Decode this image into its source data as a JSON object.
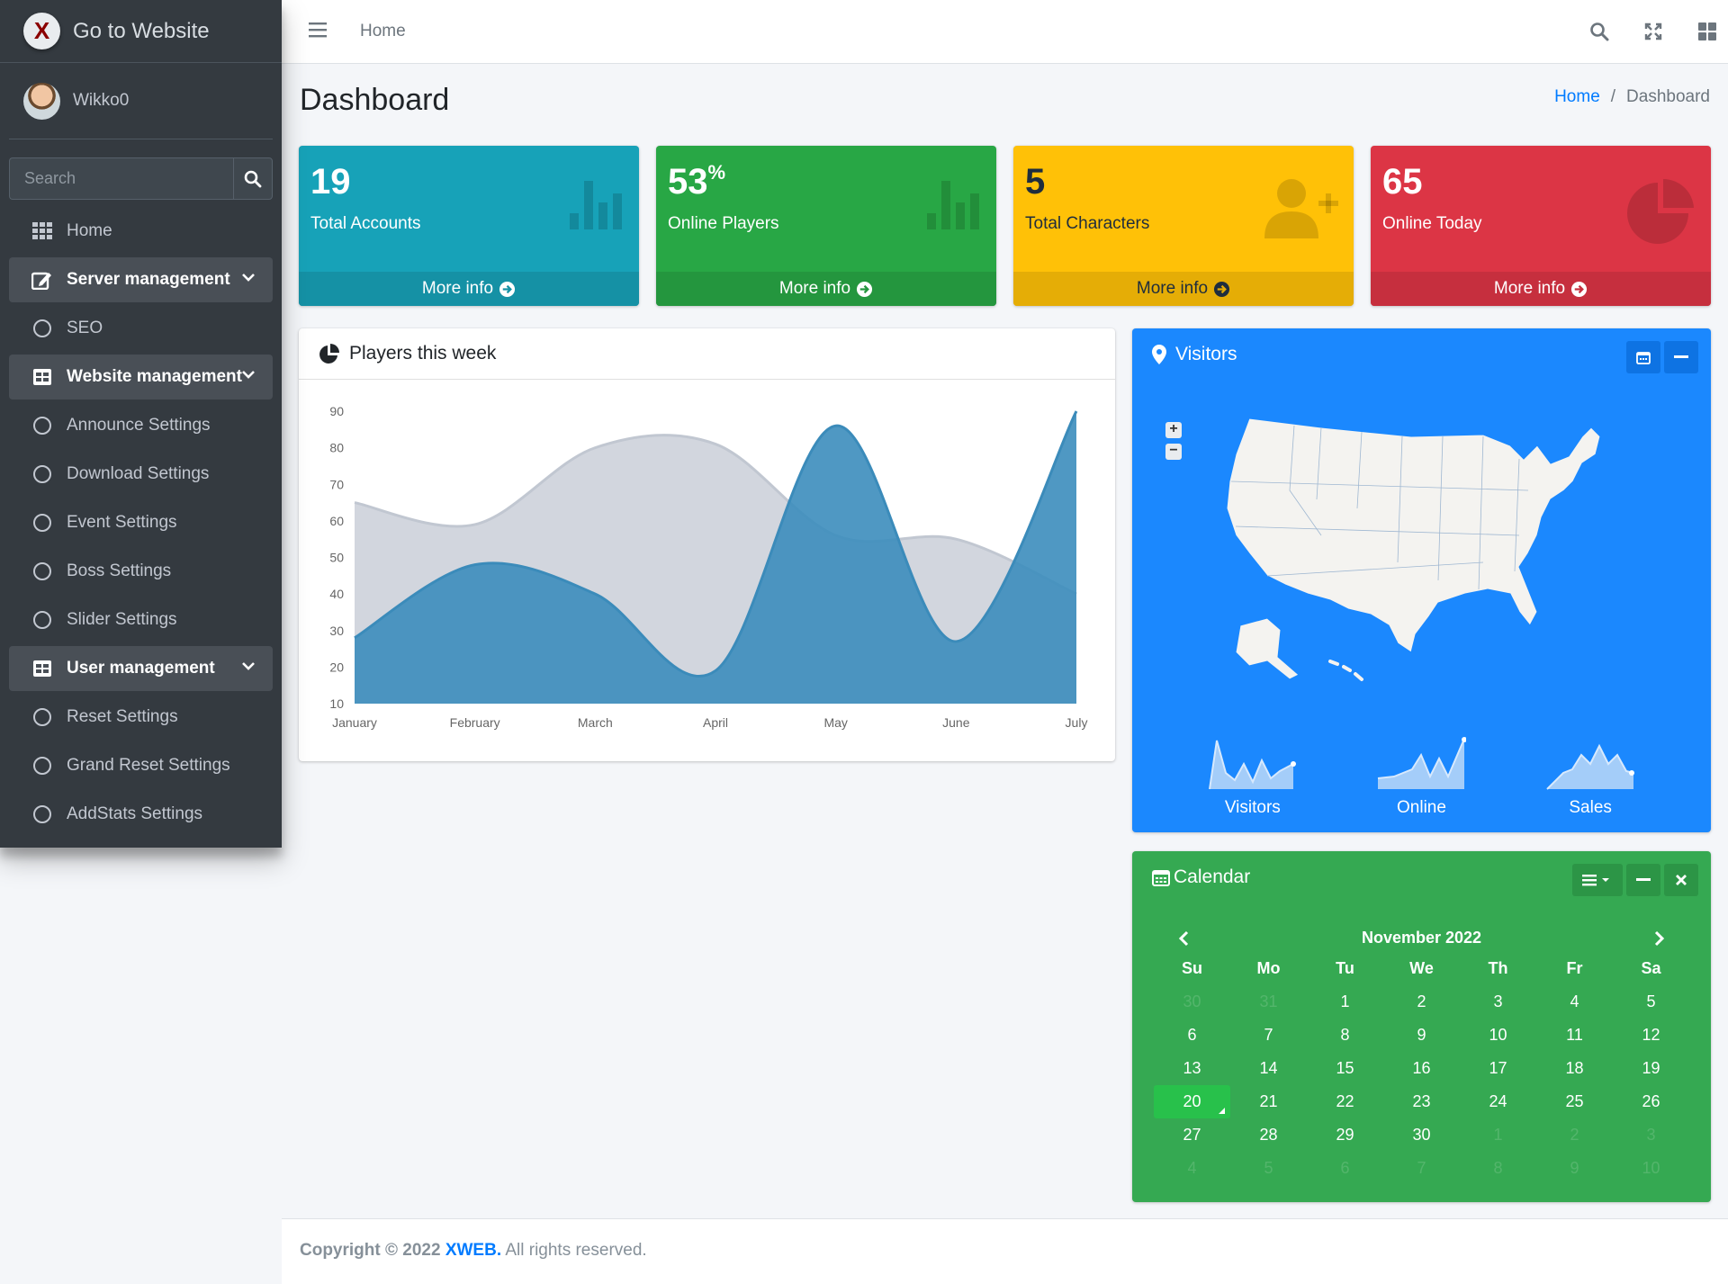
{
  "brand": {
    "logo_letter": "X",
    "title": "Go to Website"
  },
  "user": {
    "name": "Wikko0"
  },
  "search": {
    "placeholder": "Search"
  },
  "sidebar": {
    "items": [
      {
        "label": "Home"
      },
      {
        "label": "Server management"
      },
      {
        "label": "SEO"
      },
      {
        "label": "Website management"
      },
      {
        "label": "Announce Settings"
      },
      {
        "label": "Download Settings"
      },
      {
        "label": "Event Settings"
      },
      {
        "label": "Boss Settings"
      },
      {
        "label": "Slider Settings"
      },
      {
        "label": "User management"
      },
      {
        "label": "Reset Settings"
      },
      {
        "label": "Grand Reset Settings"
      },
      {
        "label": "AddStats Settings"
      }
    ]
  },
  "topbar": {
    "home": "Home"
  },
  "header": {
    "title": "Dashboard",
    "breadcrumb_home": "Home",
    "breadcrumb_sep": "/",
    "breadcrumb_current": "Dashboard"
  },
  "stats": [
    {
      "value": "19",
      "suffix": "",
      "label": "Total Accounts",
      "more": "More info",
      "color": "#17a2b8"
    },
    {
      "value": "53",
      "suffix": "%",
      "label": "Online Players",
      "more": "More info",
      "color": "#28a745"
    },
    {
      "value": "5",
      "suffix": "",
      "label": "Total Characters",
      "more": "More info",
      "color": "#ffc107"
    },
    {
      "value": "65",
      "suffix": "",
      "label": "Online Today",
      "more": "More info",
      "color": "#dc3545"
    }
  ],
  "players_card": {
    "title": "Players this week"
  },
  "chart_data": {
    "type": "area",
    "categories": [
      "January",
      "February",
      "March",
      "April",
      "May",
      "June",
      "July"
    ],
    "series": [
      {
        "values": [
          65,
          59,
          80,
          81,
          56,
          55,
          40
        ],
        "color": "#d2d6de"
      },
      {
        "values": [
          28,
          48,
          40,
          19,
          86,
          27,
          90
        ],
        "color": "#3c8dbc"
      }
    ],
    "ylim": [
      10,
      90
    ],
    "yticks": [
      "90",
      "80",
      "70",
      "60",
      "50",
      "40",
      "30",
      "20",
      "10"
    ],
    "grid": false
  },
  "visitors": {
    "title": "Visitors",
    "sparks": [
      {
        "label": "Visitors"
      },
      {
        "label": "Online"
      },
      {
        "label": "Sales"
      }
    ],
    "color": "#1b88fe"
  },
  "calendar": {
    "title": "Calendar",
    "month": "November 2022",
    "dow": [
      "Su",
      "Mo",
      "Tu",
      "We",
      "Th",
      "Fr",
      "Sa"
    ],
    "weeks": [
      [
        "30",
        "31",
        "1",
        "2",
        "3",
        "4",
        "5"
      ],
      [
        "6",
        "7",
        "8",
        "9",
        "10",
        "11",
        "12"
      ],
      [
        "13",
        "14",
        "15",
        "16",
        "17",
        "18",
        "19"
      ],
      [
        "20",
        "21",
        "22",
        "23",
        "24",
        "25",
        "26"
      ],
      [
        "27",
        "28",
        "29",
        "30",
        "1",
        "2",
        "3"
      ],
      [
        "4",
        "5",
        "6",
        "7",
        "8",
        "9",
        "10"
      ]
    ],
    "today": "20",
    "color": "#35a952"
  },
  "footer": {
    "copyright": "Copyright © 2022",
    "brand": "XWEB.",
    "rights": "All rights reserved."
  }
}
